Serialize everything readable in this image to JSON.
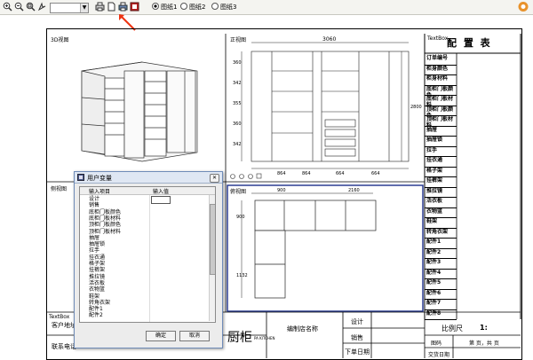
{
  "toolbar": {
    "zoom_select": "",
    "radios": [
      {
        "label": "图纸1",
        "checked": true
      },
      {
        "label": "图纸2",
        "checked": false
      },
      {
        "label": "图纸3",
        "checked": false
      }
    ]
  },
  "views": {
    "view3d": "3D视图",
    "front": "正视图",
    "side": "侧视图",
    "top": "俯视图"
  },
  "dims": {
    "front_total": "3060",
    "front_bottom": [
      "864",
      "864",
      "664",
      "664"
    ],
    "front_heights": [
      "360",
      "342",
      "355",
      "360",
      "342"
    ],
    "front_right": "2800",
    "top_w1": "900",
    "top_w2": "2160",
    "top_h1": "900",
    "top_h2": "1132"
  },
  "config": {
    "textbox": "TextBox",
    "title": "配 置 表",
    "rows": [
      "订单编号",
      "柜身颜色",
      "柜身材料",
      "底柜门板颜色",
      "底柜门板材料",
      "顶柜门板颜色",
      "顶柜门板材料",
      "抽屉",
      "抽屉锁",
      "拉手",
      "挂衣通",
      "格子架",
      "挂裤架",
      "推拉镜",
      "活衣板",
      "衣物篮",
      "鞋架",
      "转角衣架",
      "配件1",
      "配件2",
      "配件3",
      "配件4",
      "配件5",
      "配件6",
      "配件7",
      "配件8"
    ]
  },
  "title_block": {
    "textbox": "TextBox",
    "customer_address": "客户地址",
    "contact_phone": "联系电话",
    "logo": "厨柜",
    "logo_sub": "PA KITCHEN",
    "shop": "编制店名称",
    "design": "设计",
    "sales": "销售",
    "order_date": "下单日期",
    "scale_label": "比例尺",
    "scale_value": "1:",
    "drawing_no": "图码",
    "page_info": "第 页，共 页",
    "delivery_date": "交货日期"
  },
  "dialog": {
    "title": "用户变量",
    "col_item": "输入项目",
    "col_value": "输入值",
    "items": [
      "设计",
      "销售",
      "底柜门板颜色",
      "底柜门板材料",
      "顶柜门板颜色",
      "顶柜门板材料",
      "抽屉",
      "抽屉锁",
      "拉手",
      "挂衣通",
      "格子架",
      "挂裤架",
      "推拉镜",
      "活衣板",
      "衣物篮",
      "鞋架",
      "转角衣架",
      "配件1",
      "配件2"
    ],
    "ok": "确定",
    "cancel": "取消"
  }
}
